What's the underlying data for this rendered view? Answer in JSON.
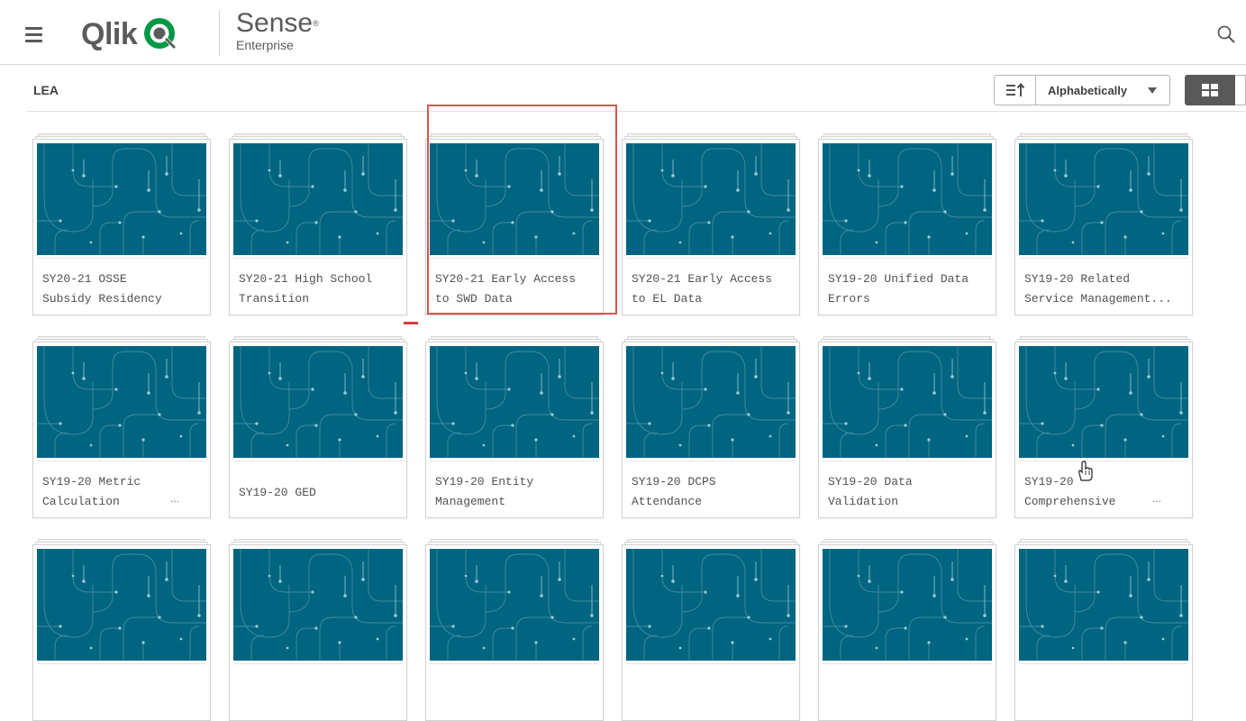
{
  "header": {
    "logo_text": "Qlik",
    "product_name": "Sense",
    "product_sub": "Enterprise",
    "icons": {
      "menu": "hamburger-menu-icon",
      "search": "search-icon",
      "logo": "qlik-logo-icon"
    }
  },
  "stream": {
    "title": "LEA"
  },
  "toolbar": {
    "sort_value": "Alphabetically",
    "sort_direction_icon": "sort-ascending-icon",
    "view_mode": "grid"
  },
  "colors": {
    "thumbnail_bg": "#006580",
    "highlight": "#d9534f",
    "grid_toggle_bg": "#595959"
  },
  "apps": [
    {
      "line1": "SY20-21 OSSE",
      "line2": "Subsidy Residency"
    },
    {
      "line1": "SY20-21 High School",
      "line2": "Transition"
    },
    {
      "line1": "SY20-21 Early Access",
      "line2": "to SWD Data"
    },
    {
      "line1": "SY20-21 Early Access",
      "line2": "to EL Data"
    },
    {
      "line1": "SY19-20 Unified Data",
      "line2": "Errors"
    },
    {
      "line1": "SY19-20 Related",
      "line2": "Service Management..."
    },
    {
      "line1": "SY19-20 Metric",
      "line2": "Calculation",
      "ellipsis": "..."
    },
    {
      "line1": "SY19-20 GED",
      "line2": ""
    },
    {
      "line1": "SY19-20 Entity",
      "line2": "Management"
    },
    {
      "line1": "SY19-20 DCPS",
      "line2": "Attendance"
    },
    {
      "line1": "SY19-20 Data",
      "line2": "Validation"
    },
    {
      "line1": "SY19-20",
      "line2": "Comprehensive",
      "ellipsis": "..."
    },
    {
      "line1": "",
      "line2": ""
    },
    {
      "line1": "",
      "line2": ""
    },
    {
      "line1": "",
      "line2": ""
    },
    {
      "line1": "",
      "line2": ""
    },
    {
      "line1": "",
      "line2": ""
    },
    {
      "line1": "",
      "line2": ""
    }
  ]
}
